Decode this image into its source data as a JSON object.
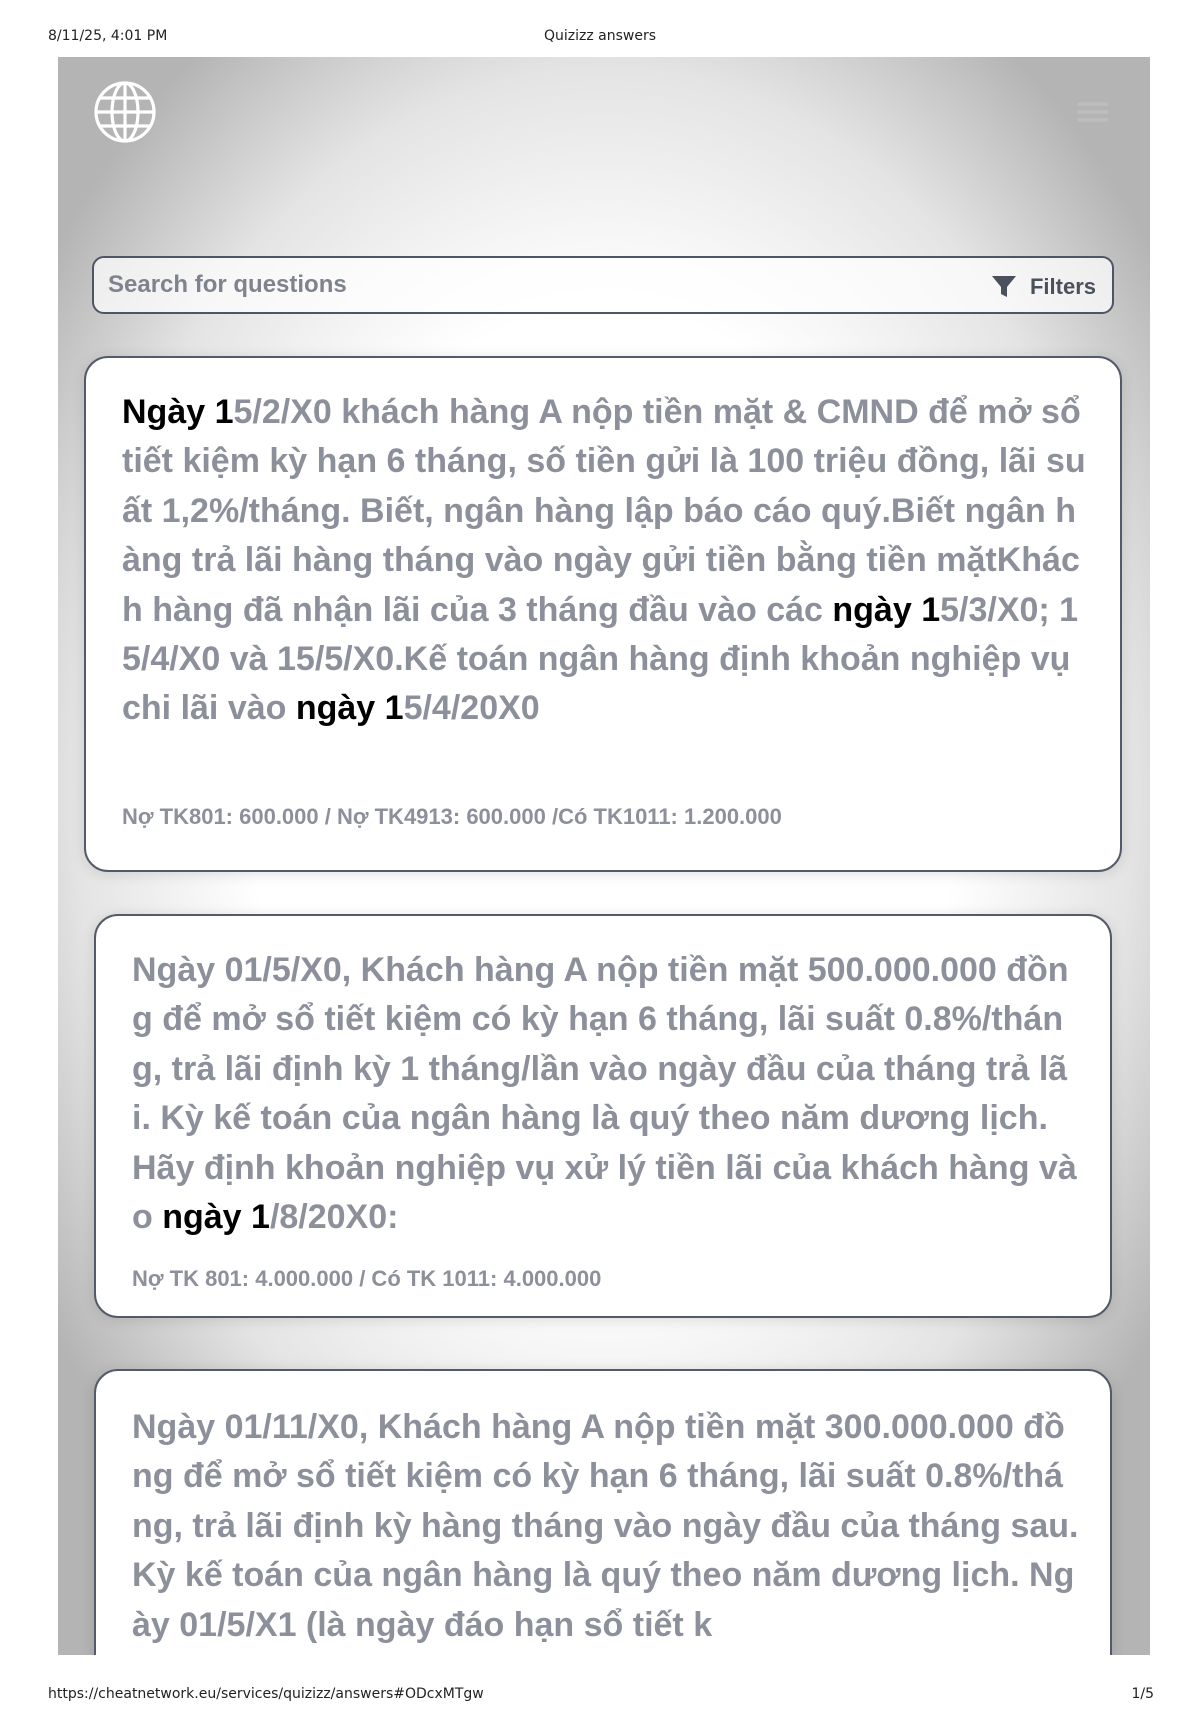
{
  "print_header": {
    "datetime": "8/11/25, 4:01 PM",
    "title": "Quizizz answers"
  },
  "print_footer": {
    "url": "https://cheatnetwork.eu/services/quizizz/answers#ODcxMTgw",
    "page": "1/5"
  },
  "topbar": {
    "logo_icon": "globe-icon",
    "menu_icon": "hamburger-menu-icon"
  },
  "search": {
    "placeholder": "Search for questions",
    "value": "",
    "filters_label": "Filters",
    "filters_icon": "funnel-icon"
  },
  "colors": {
    "text_muted": "#8c909a",
    "highlight": "#000000",
    "card_border": "#535a68"
  },
  "questions": [
    {
      "segments": [
        {
          "text": "Ngày 1",
          "hl": true
        },
        {
          "text": "5/2/X0 khách hàng A nộp tiền mặt & CMND để mở sổ tiết kiệm kỳ hạn 6 tháng, số tiền gửi là 100 triệu đồng, lãi suất 1,2%/tháng. Biết, ngân hàng lập báo cáo quý.Biết ngân hàng trả lãi hàng tháng vào ngày gửi tiền bằng tiền mặtKhách hàng đã nhận lãi của 3 tháng đầu vào các ",
          "hl": false
        },
        {
          "text": "ngày 1",
          "hl": true
        },
        {
          "text": "5/3/X0; 15/4/X0 và 15/5/X0.Kế toán ngân hàng định khoản nghiệp vụ chi lãi vào ",
          "hl": false
        },
        {
          "text": "ngày 1",
          "hl": true
        },
        {
          "text": "5/4/20X0",
          "hl": false
        }
      ],
      "answer": "Nợ TK801: 600.000 / Nợ TK4913: 600.000 /Có TK1011: 1.200.000"
    },
    {
      "segments": [
        {
          "text": "Ngày 01/5/X0, Khách hàng A nộp tiền mặt 500.000.000 đồng để mở sổ tiết kiệm có kỳ hạn 6 tháng, lãi suất 0.8%/tháng, trả lãi định kỳ 1 tháng/lần vào ngày đầu của tháng trả lãi. Kỳ kế toán của ngân hàng là quý theo năm dương lịch. Hãy định khoản nghiệp vụ xử lý tiền lãi của khách hàng vào ",
          "hl": false
        },
        {
          "text": "ngày 1",
          "hl": true
        },
        {
          "text": "/8/20X0:",
          "hl": false
        }
      ],
      "answer": "Nợ TK 801: 4.000.000 / Có TK 1011: 4.000.000"
    },
    {
      "segments": [
        {
          "text": "Ngày 01/11/X0, Khách hàng A nộp tiền mặt 300.000.000 đồng để mở sổ tiết kiệm có kỳ hạn 6 tháng, lãi suất 0.8%/tháng, trả lãi định kỳ hàng tháng vào ngày đầu của tháng sau. Kỳ kế toán của ngân hàng là quý theo năm dương lịch. Ngày 01/5/X1 (là ngày đáo hạn sổ tiết k",
          "hl": false
        }
      ],
      "answer": ""
    }
  ]
}
